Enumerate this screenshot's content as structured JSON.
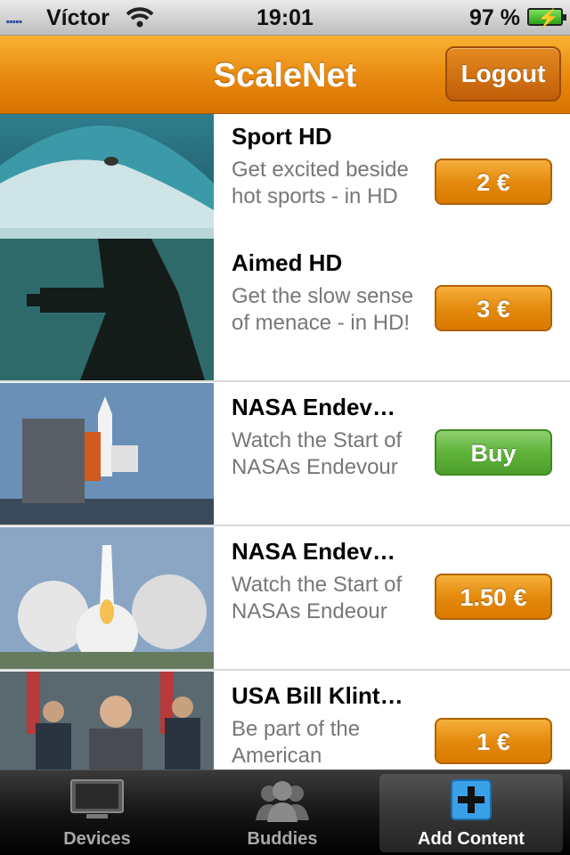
{
  "status_bar": {
    "carrier": "Víctor",
    "signal_icon": "signal-dots-icon",
    "wifi_icon": "wifi-icon",
    "time": "19:01",
    "battery_percent": "97 %",
    "battery_icon": "battery-charging-icon"
  },
  "nav": {
    "title": "ScaleNet",
    "logout_label": "Logout"
  },
  "colors": {
    "nav_orange": "#f0a020",
    "price_orange": "#e48a0d",
    "buy_green": "#5fb33a"
  },
  "items": [
    {
      "title": "Sport HD",
      "description": "Get excited beside hot sports - in HD",
      "button": "2 €",
      "button_style": "orange"
    },
    {
      "title": "Aimed HD",
      "description": "Get the slow sense of menace - in HD!",
      "button": "3 €",
      "button_style": "orange"
    },
    {
      "title": "NASA Endev…",
      "description": "Watch the Start of NASAs Endevour",
      "button": "Buy",
      "button_style": "green"
    },
    {
      "title": "NASA Endev…",
      "description": "Watch the Start of NASAs Endeour",
      "button": "1.50 €",
      "button_style": "orange"
    },
    {
      "title": "USA Bill Klint…",
      "description": "Be part of the American",
      "button": "1 €",
      "button_style": "orange"
    }
  ],
  "tabs": [
    {
      "label": "Devices",
      "icon": "tv-icon"
    },
    {
      "label": "Buddies",
      "icon": "people-icon"
    },
    {
      "label": "Add Content",
      "icon": "add-plus-icon",
      "selected": true
    }
  ]
}
